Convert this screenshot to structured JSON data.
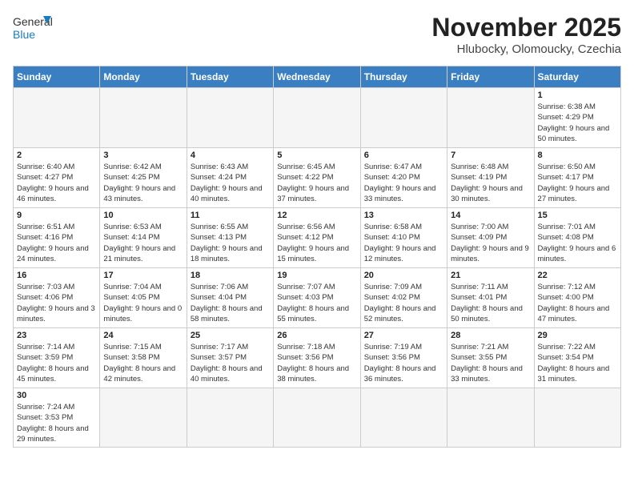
{
  "logo": {
    "text_general": "General",
    "text_blue": "Blue"
  },
  "title": "November 2025",
  "location": "Hlubocky, Olomoucky, Czechia",
  "days_of_week": [
    "Sunday",
    "Monday",
    "Tuesday",
    "Wednesday",
    "Thursday",
    "Friday",
    "Saturday"
  ],
  "weeks": [
    [
      {
        "day": "",
        "info": ""
      },
      {
        "day": "",
        "info": ""
      },
      {
        "day": "",
        "info": ""
      },
      {
        "day": "",
        "info": ""
      },
      {
        "day": "",
        "info": ""
      },
      {
        "day": "",
        "info": ""
      },
      {
        "day": "1",
        "info": "Sunrise: 6:38 AM\nSunset: 4:29 PM\nDaylight: 9 hours and 50 minutes."
      }
    ],
    [
      {
        "day": "2",
        "info": "Sunrise: 6:40 AM\nSunset: 4:27 PM\nDaylight: 9 hours and 46 minutes."
      },
      {
        "day": "3",
        "info": "Sunrise: 6:42 AM\nSunset: 4:25 PM\nDaylight: 9 hours and 43 minutes."
      },
      {
        "day": "4",
        "info": "Sunrise: 6:43 AM\nSunset: 4:24 PM\nDaylight: 9 hours and 40 minutes."
      },
      {
        "day": "5",
        "info": "Sunrise: 6:45 AM\nSunset: 4:22 PM\nDaylight: 9 hours and 37 minutes."
      },
      {
        "day": "6",
        "info": "Sunrise: 6:47 AM\nSunset: 4:20 PM\nDaylight: 9 hours and 33 minutes."
      },
      {
        "day": "7",
        "info": "Sunrise: 6:48 AM\nSunset: 4:19 PM\nDaylight: 9 hours and 30 minutes."
      },
      {
        "day": "8",
        "info": "Sunrise: 6:50 AM\nSunset: 4:17 PM\nDaylight: 9 hours and 27 minutes."
      }
    ],
    [
      {
        "day": "9",
        "info": "Sunrise: 6:51 AM\nSunset: 4:16 PM\nDaylight: 9 hours and 24 minutes."
      },
      {
        "day": "10",
        "info": "Sunrise: 6:53 AM\nSunset: 4:14 PM\nDaylight: 9 hours and 21 minutes."
      },
      {
        "day": "11",
        "info": "Sunrise: 6:55 AM\nSunset: 4:13 PM\nDaylight: 9 hours and 18 minutes."
      },
      {
        "day": "12",
        "info": "Sunrise: 6:56 AM\nSunset: 4:12 PM\nDaylight: 9 hours and 15 minutes."
      },
      {
        "day": "13",
        "info": "Sunrise: 6:58 AM\nSunset: 4:10 PM\nDaylight: 9 hours and 12 minutes."
      },
      {
        "day": "14",
        "info": "Sunrise: 7:00 AM\nSunset: 4:09 PM\nDaylight: 9 hours and 9 minutes."
      },
      {
        "day": "15",
        "info": "Sunrise: 7:01 AM\nSunset: 4:08 PM\nDaylight: 9 hours and 6 minutes."
      }
    ],
    [
      {
        "day": "16",
        "info": "Sunrise: 7:03 AM\nSunset: 4:06 PM\nDaylight: 9 hours and 3 minutes."
      },
      {
        "day": "17",
        "info": "Sunrise: 7:04 AM\nSunset: 4:05 PM\nDaylight: 9 hours and 0 minutes."
      },
      {
        "day": "18",
        "info": "Sunrise: 7:06 AM\nSunset: 4:04 PM\nDaylight: 8 hours and 58 minutes."
      },
      {
        "day": "19",
        "info": "Sunrise: 7:07 AM\nSunset: 4:03 PM\nDaylight: 8 hours and 55 minutes."
      },
      {
        "day": "20",
        "info": "Sunrise: 7:09 AM\nSunset: 4:02 PM\nDaylight: 8 hours and 52 minutes."
      },
      {
        "day": "21",
        "info": "Sunrise: 7:11 AM\nSunset: 4:01 PM\nDaylight: 8 hours and 50 minutes."
      },
      {
        "day": "22",
        "info": "Sunrise: 7:12 AM\nSunset: 4:00 PM\nDaylight: 8 hours and 47 minutes."
      }
    ],
    [
      {
        "day": "23",
        "info": "Sunrise: 7:14 AM\nSunset: 3:59 PM\nDaylight: 8 hours and 45 minutes."
      },
      {
        "day": "24",
        "info": "Sunrise: 7:15 AM\nSunset: 3:58 PM\nDaylight: 8 hours and 42 minutes."
      },
      {
        "day": "25",
        "info": "Sunrise: 7:17 AM\nSunset: 3:57 PM\nDaylight: 8 hours and 40 minutes."
      },
      {
        "day": "26",
        "info": "Sunrise: 7:18 AM\nSunset: 3:56 PM\nDaylight: 8 hours and 38 minutes."
      },
      {
        "day": "27",
        "info": "Sunrise: 7:19 AM\nSunset: 3:56 PM\nDaylight: 8 hours and 36 minutes."
      },
      {
        "day": "28",
        "info": "Sunrise: 7:21 AM\nSunset: 3:55 PM\nDaylight: 8 hours and 33 minutes."
      },
      {
        "day": "29",
        "info": "Sunrise: 7:22 AM\nSunset: 3:54 PM\nDaylight: 8 hours and 31 minutes."
      }
    ],
    [
      {
        "day": "30",
        "info": "Sunrise: 7:24 AM\nSunset: 3:53 PM\nDaylight: 8 hours and 29 minutes."
      },
      {
        "day": "",
        "info": ""
      },
      {
        "day": "",
        "info": ""
      },
      {
        "day": "",
        "info": ""
      },
      {
        "day": "",
        "info": ""
      },
      {
        "day": "",
        "info": ""
      },
      {
        "day": "",
        "info": ""
      }
    ]
  ]
}
